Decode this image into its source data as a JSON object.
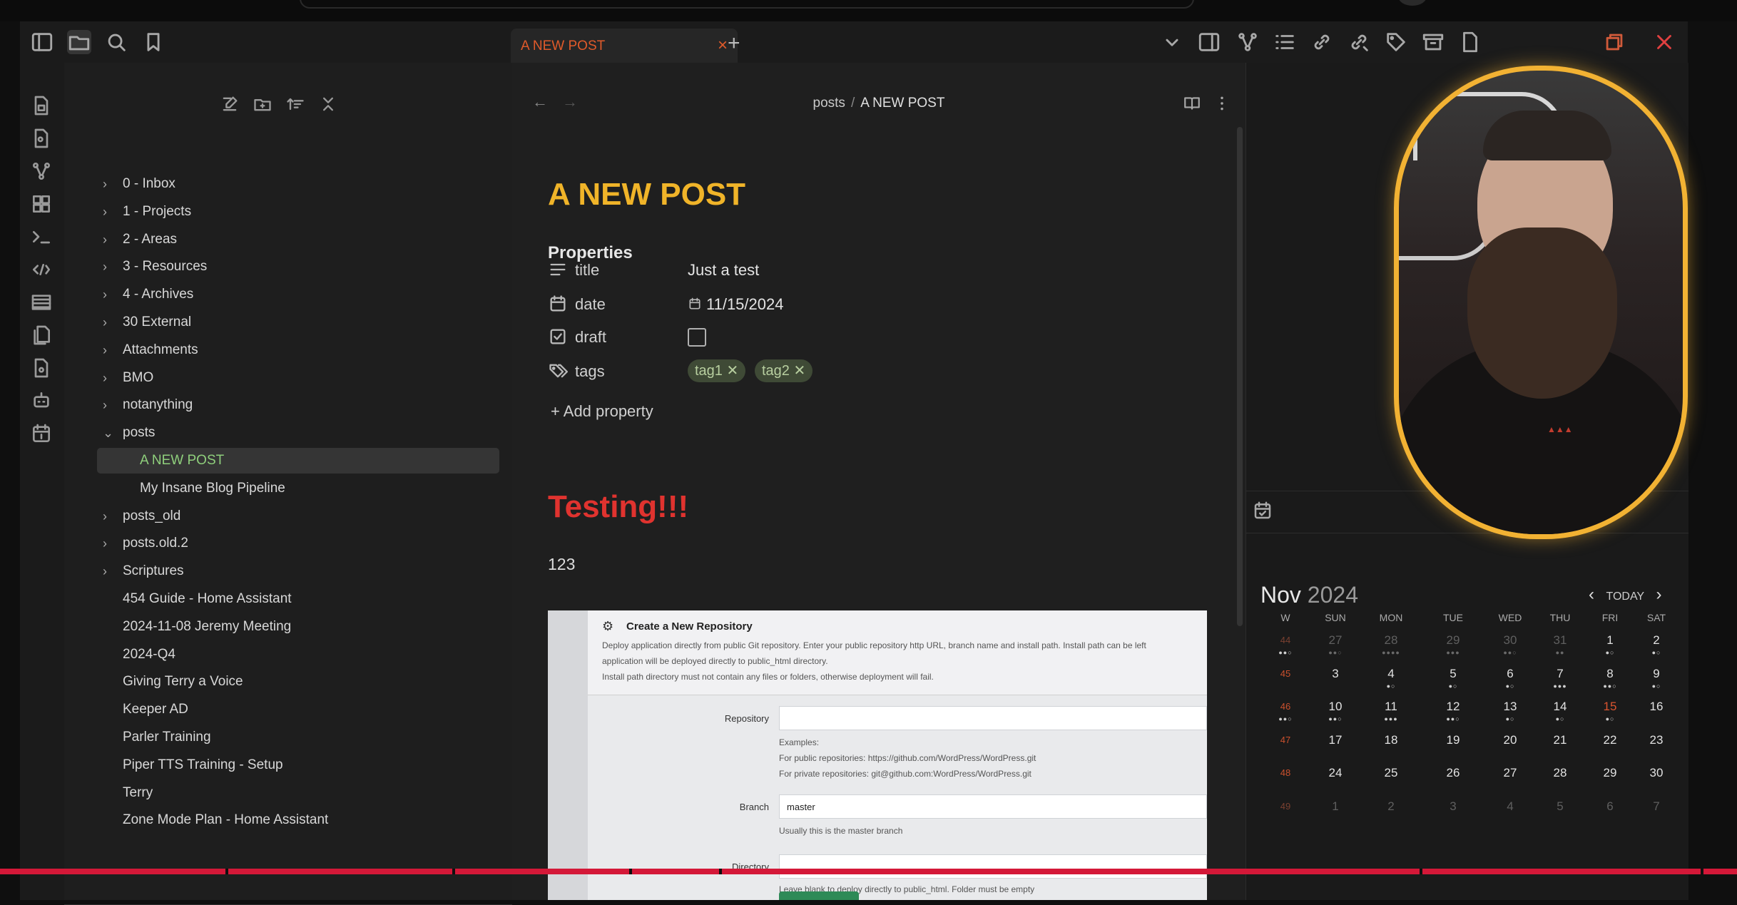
{
  "tab": {
    "title": "A NEW POST",
    "close": "×",
    "new": "+"
  },
  "breadcrumb": {
    "folder": "posts",
    "separator": "/",
    "current": "A NEW POST"
  },
  "note": {
    "title": "A NEW POST",
    "properties_heading": "Properties",
    "properties": [
      {
        "key": "title",
        "value": "Just a test",
        "icon": "text-lines-icon"
      },
      {
        "key": "date",
        "value": "11/15/2024",
        "icon": "calendar-icon"
      },
      {
        "key": "draft",
        "value": "",
        "icon": "checkbox-icon"
      },
      {
        "key": "tags",
        "value": "",
        "icon": "tags-icon"
      }
    ],
    "tags": [
      "tag1",
      "tag2"
    ],
    "add_property": "Add property",
    "heading": "Testing!!!",
    "body": "123"
  },
  "embed": {
    "title": "Create a New Repository",
    "desc1": "Deploy application directly from public Git repository. Enter your public repository http URL, branch name and install path. Install path can be left",
    "desc2": "application will be deployed directly to public_html directory.",
    "desc3": "Install path directory must not contain any files or folders, otherwise deployment will fail.",
    "repo_label": "Repository",
    "examples": "Examples:",
    "ex_public": "For public repositories: https://github.com/WordPress/WordPress.git",
    "ex_private": "For private repositories: git@github.com:WordPress/WordPress.git",
    "branch_label": "Branch",
    "branch_value": "master",
    "branch_help": "Usually this is the master branch",
    "dir_label": "Directory",
    "dir_help": "Leave blank to deploy directly to public_html. Folder must be empty"
  },
  "sidebar": {
    "folders": [
      {
        "label": "0 - Inbox"
      },
      {
        "label": "1 - Projects"
      },
      {
        "label": "2 - Areas"
      },
      {
        "label": "3 - Resources"
      },
      {
        "label": "4 - Archives"
      },
      {
        "label": "30 External"
      },
      {
        "label": "Attachments"
      },
      {
        "label": "BMO"
      },
      {
        "label": "notanything"
      },
      {
        "label": "posts"
      }
    ],
    "posts_children": [
      {
        "label": "A NEW POST"
      },
      {
        "label": "My Insane Blog Pipeline"
      }
    ],
    "folders2": [
      {
        "label": "posts_old"
      },
      {
        "label": "posts.old.2"
      },
      {
        "label": "Scriptures"
      }
    ],
    "files": [
      {
        "label": "454 Guide - Home Assistant"
      },
      {
        "label": "2024-11-08 Jeremy Meeting"
      },
      {
        "label": "2024-Q4"
      },
      {
        "label": "Giving Terry a Voice"
      },
      {
        "label": "Keeper AD"
      },
      {
        "label": "Parler Training"
      },
      {
        "label": "Piper TTS Training - Setup"
      },
      {
        "label": "Terry"
      },
      {
        "label": "Zone Mode Plan - Home Assistant"
      }
    ]
  },
  "calendar": {
    "month": "Nov",
    "year": "2024",
    "today_label": "TODAY",
    "headers": [
      "W",
      "SUN",
      "MON",
      "TUE",
      "WED",
      "THU",
      "FRI",
      "SAT"
    ],
    "weeks": [
      {
        "wk": "44",
        "days": [
          "27",
          "28",
          "29",
          "30",
          "31",
          "1",
          "2"
        ],
        "dim": [
          true,
          true,
          true,
          true,
          true,
          false,
          false
        ],
        "dots": [
          "●●○",
          "●●●●",
          "●●●",
          "●●○",
          "●●",
          "●○",
          "●○"
        ]
      },
      {
        "wk": "45",
        "days": [
          "3",
          "4",
          "5",
          "6",
          "7",
          "8",
          "9"
        ],
        "dim": [
          false,
          false,
          false,
          false,
          false,
          false,
          false
        ],
        "dots": [
          "",
          "●○",
          "●○",
          "●○",
          "●●●",
          "●●○",
          "●○"
        ]
      },
      {
        "wk": "46",
        "days": [
          "10",
          "11",
          "12",
          "13",
          "14",
          "15",
          "16"
        ],
        "dim": [
          false,
          false,
          false,
          false,
          false,
          false,
          false
        ],
        "dots": [
          "●●○",
          "●●●",
          "●●○",
          "●○",
          "●○",
          "●○",
          ""
        ]
      },
      {
        "wk": "47",
        "days": [
          "17",
          "18",
          "19",
          "20",
          "21",
          "22",
          "23"
        ],
        "dim": [
          false,
          false,
          false,
          false,
          false,
          false,
          false
        ],
        "dots": [
          "",
          "",
          "",
          "",
          "",
          "",
          ""
        ]
      },
      {
        "wk": "48",
        "days": [
          "24",
          "25",
          "26",
          "27",
          "28",
          "29",
          "30"
        ],
        "dim": [
          false,
          false,
          false,
          false,
          false,
          false,
          false
        ],
        "dots": [
          "",
          "",
          "",
          "",
          "",
          "",
          ""
        ]
      },
      {
        "wk": "49",
        "days": [
          "1",
          "2",
          "3",
          "4",
          "5",
          "6",
          "7"
        ],
        "dim": [
          true,
          true,
          true,
          true,
          true,
          true,
          true
        ],
        "dots": [
          "",
          "",
          "",
          "",
          "",
          "",
          ""
        ]
      }
    ],
    "today": "15",
    "colors": {
      "accent": "#d9542f",
      "title_orange": "#f0b429",
      "heading_red": "#e0332f",
      "tag_bg": "#3f4a36"
    }
  }
}
